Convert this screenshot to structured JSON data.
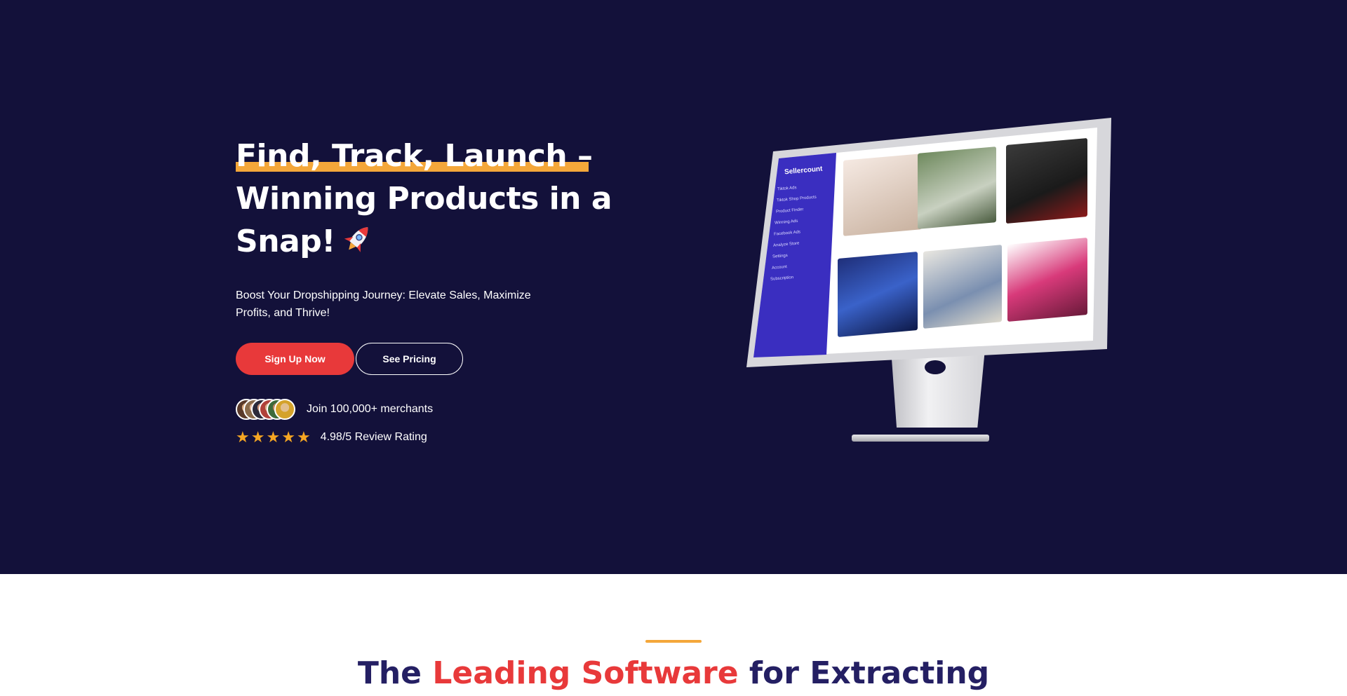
{
  "hero": {
    "headline_line1": "Find, Track, Launch –",
    "headline_line2": "Winning Products in a",
    "headline_line3": "Snap!",
    "rocket_icon": "rocket-icon",
    "subtitle": "Boost Your Dropshipping Journey: Elevate Sales, Maximize Profits, and Thrive!",
    "primary_button": "Sign Up Now",
    "secondary_button": "See Pricing",
    "merchants_text": "Join 100,000+ merchants",
    "rating_stars": 5,
    "rating_text": "4.98/5 Review Rating"
  },
  "monitor": {
    "brand": "Sellercount",
    "menu": [
      "Tiktok Ads",
      "Tiktok Shop Products",
      "Product Finder",
      "Winning Ads",
      "Facebook Ads",
      "Analyze Store",
      "Settings",
      "Account",
      "Subscription"
    ]
  },
  "section2": {
    "title_part1": "The ",
    "title_highlight": "Leading Software",
    "title_part2": " for Extracting"
  },
  "colors": {
    "hero_bg": "#13113a",
    "accent_orange": "#f4a73a",
    "primary_red": "#e8393a",
    "title_navy": "#241f63",
    "star_gold": "#f5a623"
  }
}
